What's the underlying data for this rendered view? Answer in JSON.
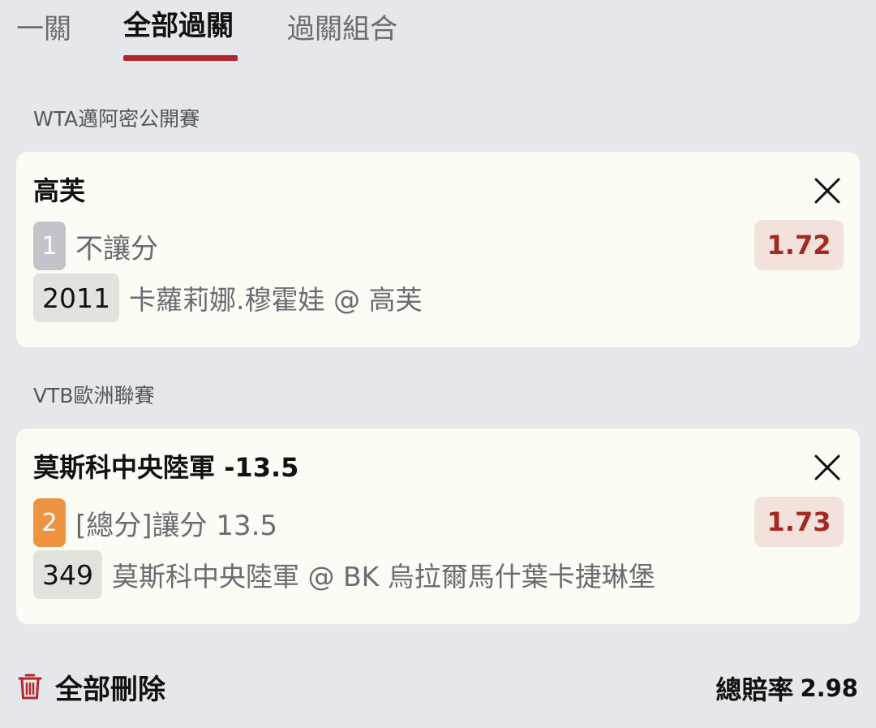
{
  "tabs": [
    {
      "label": "一關",
      "active": false
    },
    {
      "label": "全部過關",
      "active": true
    },
    {
      "label": "過關組合",
      "active": false
    }
  ],
  "bets": [
    {
      "league": "WTA邁阿密公開賽",
      "title": "高芙",
      "leg_number": "1",
      "market": "不讓分",
      "match_code": "2011",
      "selection": "卡蘿莉娜.穆霍娃 @ 高芙",
      "odds": "1.72"
    },
    {
      "league": "VTB歐洲聯賽",
      "title": "莫斯科中央陸軍 -13.5",
      "leg_number": "2",
      "market": "[總分]讓分 13.5",
      "match_code": "349",
      "selection": "莫斯科中央陸軍 @ BK 烏拉爾馬什葉卡捷琳堡",
      "odds": "1.73"
    }
  ],
  "footer": {
    "delete_all_label": "全部刪除",
    "total_odds_label": "總賠率",
    "total_odds_value": "2.98"
  },
  "icons": {
    "close": "close-icon",
    "delete": "trash-icon"
  },
  "colors": {
    "accent": "#b3262b",
    "odds_text": "#a32a23",
    "odds_bg": "#f3e2dc",
    "leg1_badge": "#c4c5cc",
    "leg2_badge": "#ee9441",
    "card_bg": "#fcfcf4",
    "page_bg": "#e6e7ea"
  }
}
